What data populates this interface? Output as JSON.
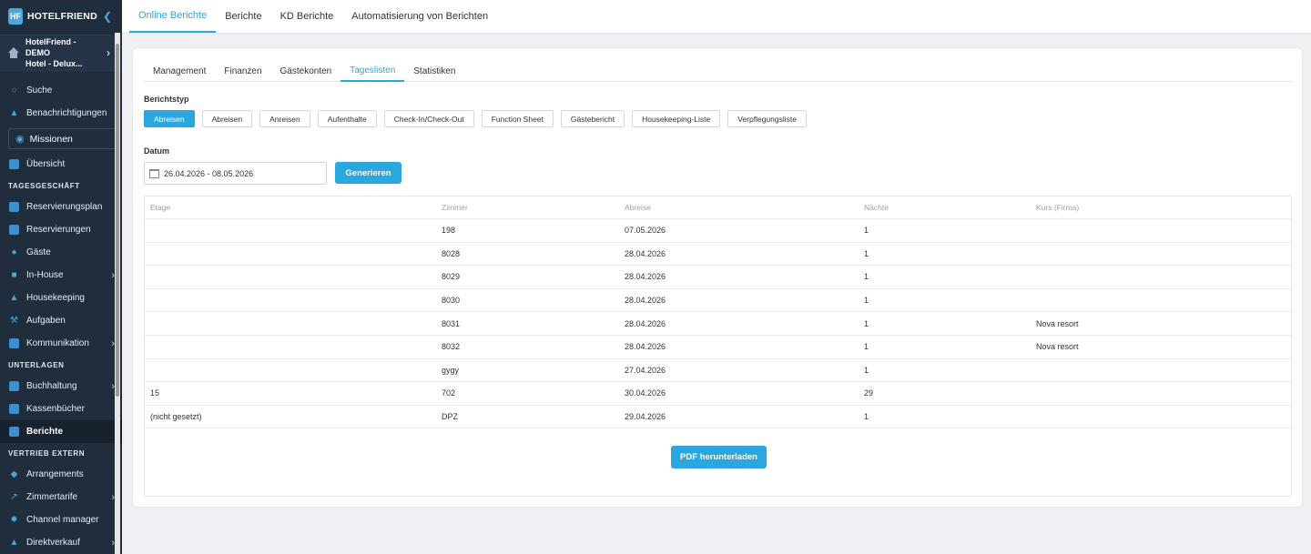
{
  "brand": {
    "name": "HOTELFRIEND",
    "logo_text": "HF",
    "collapse_icon": "chevron-left-icon"
  },
  "hotel": {
    "line1": "HotelFriend - DEMO",
    "line2": "Hotel - Delux..."
  },
  "sidebar": {
    "top_items": [
      {
        "label": "Suche",
        "icon": "search-icon"
      },
      {
        "label": "Benachrichtigungen",
        "icon": "bell-icon"
      }
    ],
    "missions_label": "Missionen",
    "overview_label": "Übersicht",
    "section_tagesgeschaeft": "TAGESGESCHÄFT",
    "tages_items": [
      {
        "label": "Reservierungsplan"
      },
      {
        "label": "Reservierungen"
      },
      {
        "label": "Gäste"
      },
      {
        "label": "In-House"
      },
      {
        "label": "Housekeeping"
      },
      {
        "label": "Aufgaben"
      },
      {
        "label": "Kommunikation"
      }
    ],
    "section_unterlagen": "UNTERLAGEN",
    "unterlagen_items": [
      {
        "label": "Buchhaltung"
      },
      {
        "label": "Kassenbücher"
      },
      {
        "label": "Berichte"
      }
    ],
    "section_vertrieb": "VERTRIEB EXTERN",
    "vertrieb_items": [
      {
        "label": "Arrangements"
      },
      {
        "label": "Zimmertarife"
      },
      {
        "label": "Channel manager"
      },
      {
        "label": "Direktverkauf"
      }
    ]
  },
  "top_tabs": [
    "Online Berichte",
    "Berichte",
    "KD Berichte",
    "Automatisierung von Berichten"
  ],
  "sub_tabs": [
    "Management",
    "Finanzen",
    "Gästekonten",
    "Tageslisten",
    "Statistiken"
  ],
  "report_type_label": "Berichtstyp",
  "report_types": [
    "Abreisen",
    "Abreisen",
    "Anreisen",
    "Aufenthalte",
    "Check-In/Check-Out",
    "Function Sheet",
    "Gästebericht",
    "Housekeeping-Liste",
    "Verpflegungsliste"
  ],
  "date_label": "Datum",
  "date_value": "26.04.2026 - 08.05.2026",
  "generate_label": "Generieren",
  "table": {
    "headers": [
      "Etage",
      "Zimmer",
      "Abreise",
      "Nächte",
      "Kurs (Firma)"
    ],
    "rows": [
      [
        "",
        "198",
        "07.05.2026",
        "1",
        ""
      ],
      [
        "",
        "8028",
        "28.04.2026",
        "1",
        ""
      ],
      [
        "",
        "8029",
        "28.04.2026",
        "1",
        ""
      ],
      [
        "",
        "8030",
        "28.04.2026",
        "1",
        ""
      ],
      [
        "",
        "8031",
        "28.04.2026",
        "1",
        "Nova resort"
      ],
      [
        "",
        "8032",
        "28.04.2026",
        "1",
        "Nova resort"
      ],
      [
        "",
        "gygy",
        "27.04.2026",
        "1",
        ""
      ],
      [
        "15",
        "702",
        "30.04.2026",
        "29",
        ""
      ],
      [
        "(nicht gesetzt)",
        "DPZ",
        "29.04.2026",
        "1",
        ""
      ]
    ]
  },
  "pdf_label": "PDF herunterladen",
  "colors": {
    "accent": "#2aa7df",
    "sidebar": "#1f2d3d"
  }
}
